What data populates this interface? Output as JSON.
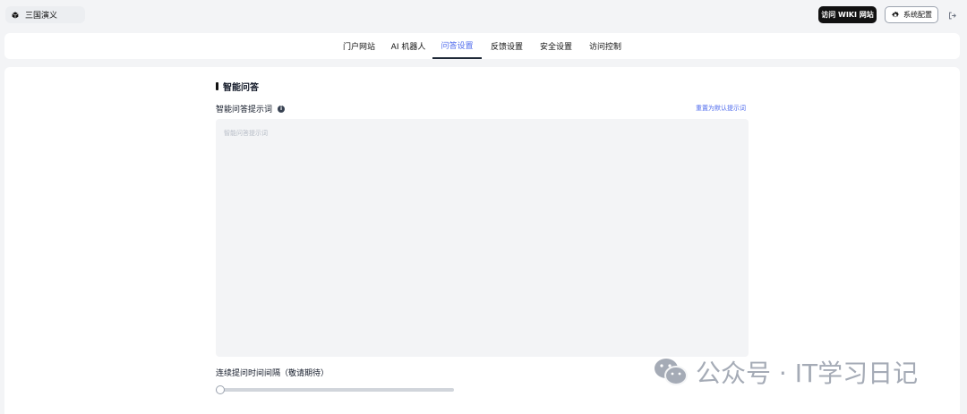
{
  "app": {
    "name": "三国演义"
  },
  "header": {
    "visit_wiki_label": "访问 WIKI 网站",
    "system_config_label": "系统配置"
  },
  "tabs": [
    {
      "label": "门户网站",
      "active": false
    },
    {
      "label": "AI 机器人",
      "active": false
    },
    {
      "label": "问答设置",
      "active": true
    },
    {
      "label": "反馈设置",
      "active": false
    },
    {
      "label": "安全设置",
      "active": false
    },
    {
      "label": "访问控制",
      "active": false
    }
  ],
  "section": {
    "title": "智能问答",
    "prompt_label": "智能问答提示词",
    "reset_link": "重置为默认提示词",
    "prompt_value": "",
    "prompt_placeholder": "智能问答提示词",
    "interval_label": "连续提问时间间隔（敬请期待）",
    "interval_value": 0
  },
  "watermark": {
    "text": "公众号 · IT学习日记"
  },
  "colors": {
    "accent": "#4f6bed",
    "dark_button": "#111111"
  }
}
